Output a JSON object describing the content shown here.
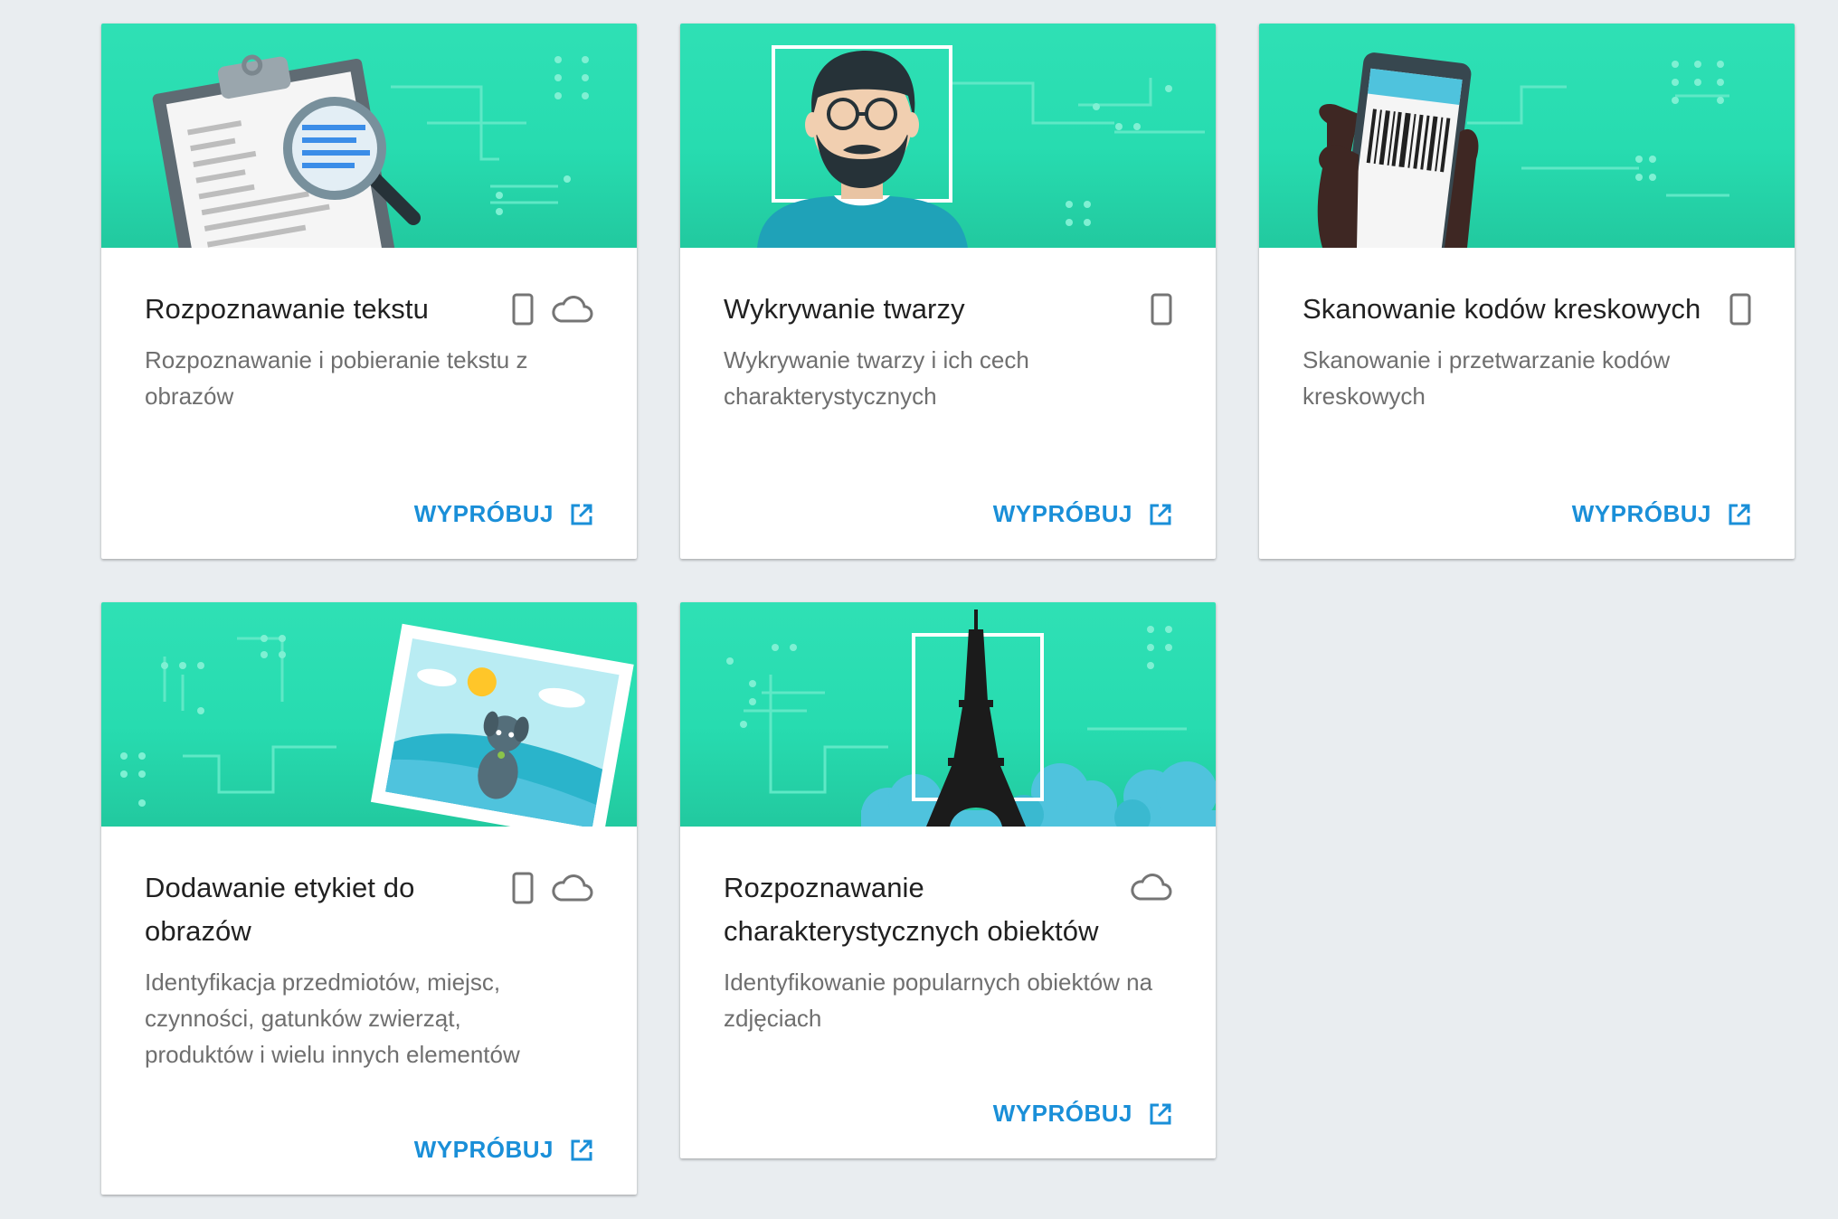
{
  "colors": {
    "page_bg": "#e9edf0",
    "banner_green": "#28dcb1",
    "accent_blue": "#1a8fd8",
    "title_text": "#212121",
    "desc_text": "#6f6f6f",
    "icon_gray": "#757575"
  },
  "cards": [
    {
      "title": "Rozpoznawanie tekstu",
      "description": "Rozpoznawanie i pobieranie tekstu z obrazów",
      "action_label": "WYPRÓBUJ",
      "icons": [
        "phone-icon",
        "cloud-icon"
      ],
      "illustration": "clipboard-magnifier-illustration"
    },
    {
      "title": "Wykrywanie twarzy",
      "description": "Wykrywanie twarzy i ich cech charakterystycznych",
      "action_label": "WYPRÓBUJ",
      "icons": [
        "phone-icon"
      ],
      "illustration": "face-detection-illustration"
    },
    {
      "title": "Skanowanie kodów kreskowych",
      "description": "Skanowanie i przetwarzanie kodów kreskowych",
      "action_label": "WYPRÓBUJ",
      "icons": [
        "phone-icon"
      ],
      "illustration": "barcode-phone-illustration"
    },
    {
      "title": "Dodawanie etykiet do obrazów",
      "description": "Identyfikacja przedmiotów, miejsc, czynności, gatunków zwierząt, produktów i wielu innych elementów",
      "action_label": "WYPRÓBUJ",
      "icons": [
        "phone-icon",
        "cloud-icon"
      ],
      "illustration": "dog-photo-illustration"
    },
    {
      "title": "Rozpoznawanie charakterystycznych obiektów",
      "description": "Identyfikowanie popularnych obiektów na zdjęciach",
      "action_label": "WYPRÓBUJ",
      "icons": [
        "cloud-icon"
      ],
      "illustration": "eiffel-tower-illustration"
    }
  ]
}
